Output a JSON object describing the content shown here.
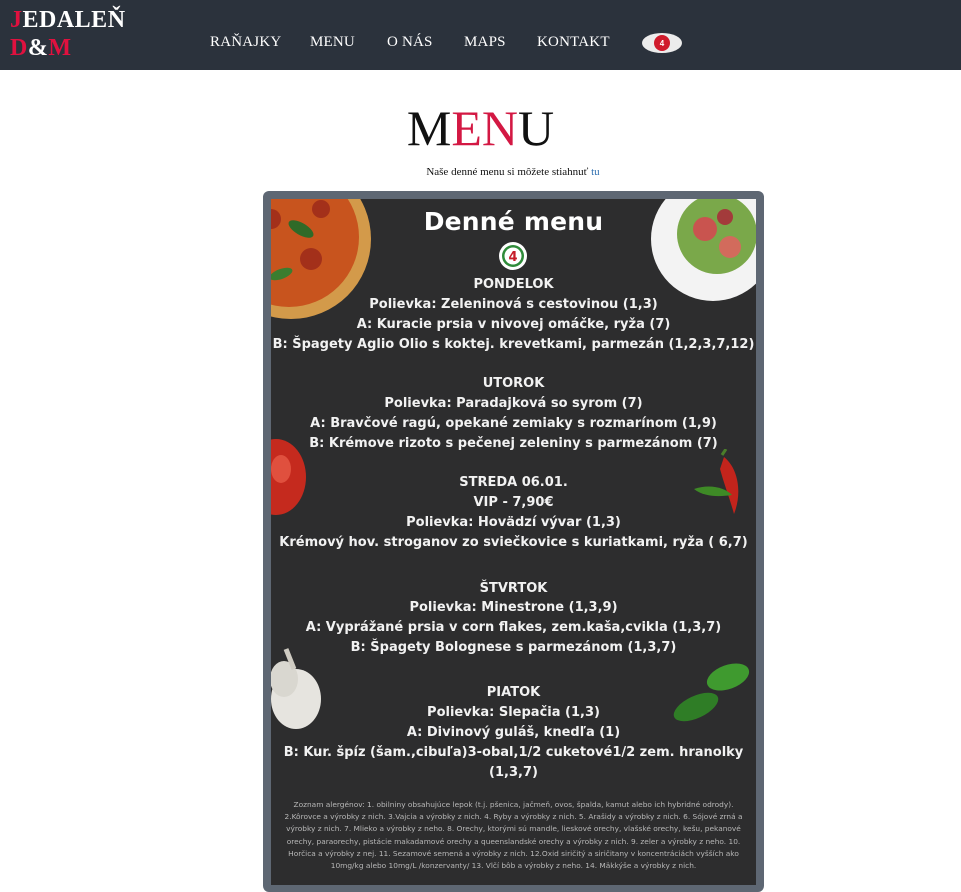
{
  "header": {
    "logo_line1_first": "J",
    "logo_line1_rest": "EDALEŇ",
    "logo_line2_d": "D",
    "logo_line2_amp": "&",
    "logo_line2_m": "M",
    "nav": [
      {
        "label": "RAŇAJKY"
      },
      {
        "label": "MENU"
      },
      {
        "label": "O NÁS"
      },
      {
        "label": "MAPS"
      },
      {
        "label": "KONTAKT"
      }
    ],
    "badge_text": "4"
  },
  "page": {
    "title_m": "M",
    "title_en": "EN",
    "title_u": "U",
    "subtitle_text": "Naše denné menu si môžete stiahnuť",
    "subtitle_link": "tu"
  },
  "menu_image": {
    "title": "Denné menu",
    "logo_text": "4",
    "lines": [
      "PONDELOK",
      "Polievka: Zeleninová s cestovinou (1,3)",
      "A: Kuracie prsia v nivovej omáčke, ryža (7)",
      "B: Špagety Aglio Olio s koktej. krevetkami, parmezán (1,2,3,7,12)",
      "UTOROK",
      "Polievka: Paradajková so syrom (7)",
      "A: Bravčové ragú, opekané zemiaky s rozmarínom (1,9)",
      "B: Krémove rizoto s pečenej zeleniny s parmezánom (7)",
      "STREDA 06.01.",
      "VIP - 7,90€",
      "Polievka: Hovädzí vývar (1,3)",
      "Krémový hov. stroganov zo sviečkovice s kuriatkami, ryža ( 6,7)",
      "ŠTVRTOK",
      "Polievka: Minestrone (1,3,9)",
      "A: Vyprážané prsia v corn flakes, zem.kaša,cvikla (1,3,7)",
      "B: Špagety Bolognese s parmezánom (1,3,7)",
      "PIATOK",
      "Polievka: Slepačia (1,3)",
      "A: Divinový guláš, knedľa (1)",
      "B: Kur. špíz (šam.,cibuľa)3-obal,1/2 cuketové1/2 zem.  hranolky",
      "(1,3,7)"
    ],
    "allergens": "Zoznam alergénov: 1. obilniny obsahujúce lepok (t.j. pšenica, jačmeň, ovos, špalda, kamut alebo ich hybridné odrody). 2.Kôrovce a výrobky z nich. 3.Vajcia a výrobky z nich. 4. Ryby a výrobky z nich. 5. Arašidy a výrobky z nich. 6. Sójové zrná a výrobky z nich. 7. Mlieko a výrobky z neho. 8. Orechy, ktorými sú mandle, lieskové orechy, vlašské orechy, kešu, pekanové orechy, paraorechy, pistácie makadamové orechy a queenslandské orechy a výrobky z nich. 9. zeler a výrobky z neho. 10. Horčica a výrobky z nej. 11. Sezamové semená a výrobky z nich. 12.Oxid siričitý a siričitany v koncentráciách vyšších ako 10mg/kg alebo 10mg/L /konzervanty/ 13. Vlčí bôb a výrobky z neho. 14. Mäkkýše a výrobky z nich."
  },
  "colors": {
    "header_bg": "#2b323c",
    "accent_red": "#d31843",
    "frame": "#5e6773",
    "board_bg": "#2d2d2e",
    "link": "#2f6fb0"
  }
}
